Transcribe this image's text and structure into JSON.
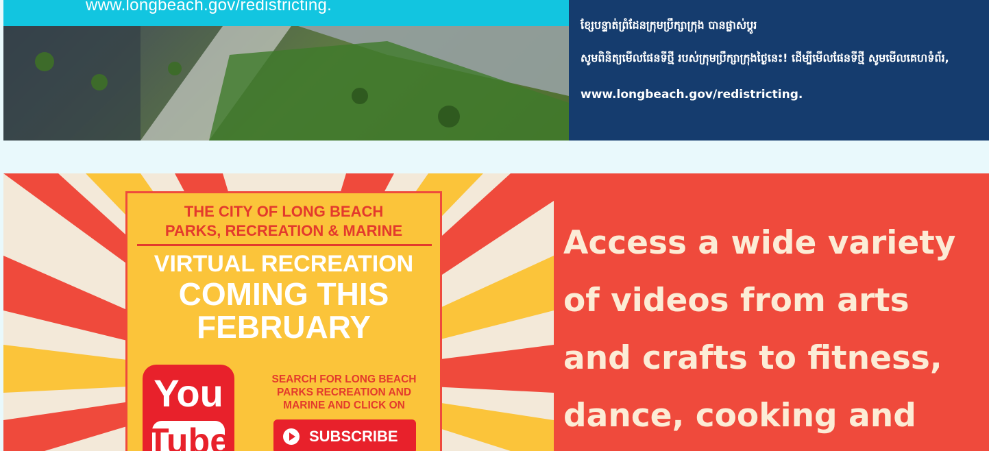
{
  "top_banner": {
    "url_strip": "www.longbeach.gov/redistricting.",
    "khmer_title": "ខ្សែបន្ទាត់ព្រំដែនក្រុមប្រឹក្សាក្រុង បានផ្លាស់ប្តូរ",
    "khmer_body": "សូមពិនិត្យមើលផែនទីថ្មី របស់ក្រុមប្រឹក្សាក្រុងថ្ងៃនេះ! ដើម្បីមើលផែនទីថ្មី សូមមើលគេហទំព័រ,",
    "info_url": "www.longbeach.gov/redistricting."
  },
  "promo": {
    "header_line1": "THE CITY OF LONG BEACH",
    "header_line2": "PARKS, RECREATION & MARINE",
    "big_line1": "VIRTUAL RECREATION",
    "big_line2": "COMING THIS",
    "big_line3": "FEBRUARY",
    "yt_you": "You",
    "yt_tube": "Tube",
    "search_line1": "SEARCH FOR LONG BEACH",
    "search_line2": "PARKS RECREATION AND",
    "search_line3": "MARINE AND CLICK ON",
    "subscribe_label": "SUBSCRIBE",
    "text_lines": [
      "Access a wide variety",
      "of videos from arts",
      "and crafts to fitness,",
      "dance, cooking and"
    ]
  },
  "colors": {
    "cyan": "#12c5e0",
    "navy": "#153c6e",
    "promo_red": "#ef4a3c",
    "poster_yellow": "#fbc43a",
    "youtube_red": "#e8212b"
  }
}
